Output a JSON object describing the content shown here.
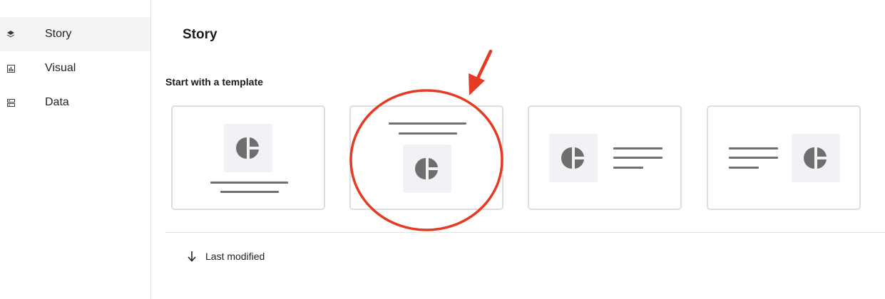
{
  "sidebar": {
    "items": [
      {
        "label": "Story",
        "icon": "layers-icon",
        "active": true
      },
      {
        "label": "Visual",
        "icon": "bar-chart-icon",
        "active": false
      },
      {
        "label": "Data",
        "icon": "database-icon",
        "active": false
      }
    ]
  },
  "main": {
    "title": "Story",
    "templates_heading": "Start with a template",
    "templates": [
      {
        "layout": "chart-top-text-bottom"
      },
      {
        "layout": "text-top-chart-bottom"
      },
      {
        "layout": "chart-left-text-right"
      },
      {
        "layout": "text-left-chart-right"
      }
    ],
    "sort": {
      "label": "Last modified",
      "icon": "arrow-down-icon"
    }
  },
  "annotation": {
    "shape": "circle",
    "color": "#e53b25",
    "target": "template-card-2",
    "arrow": true
  },
  "colors": {
    "sidebar_active_bg": "#f3f3f5",
    "chart_tile_bg": "#f2f1f5",
    "chart_icon": "#6e6e6e",
    "line": "#707070",
    "annotation": "#e53b25"
  }
}
